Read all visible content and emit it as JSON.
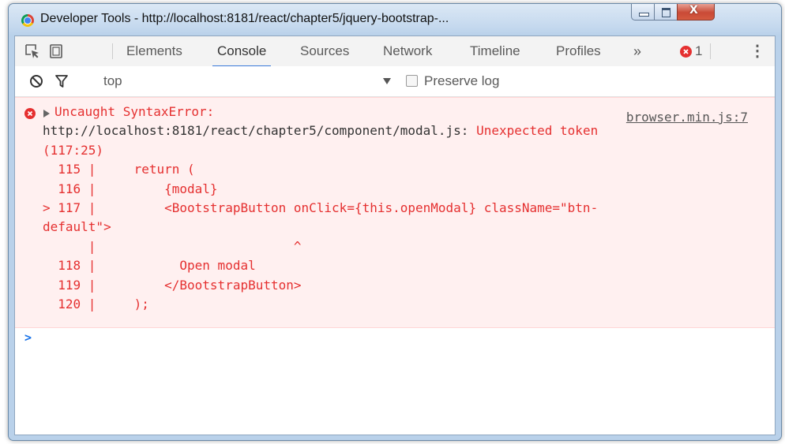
{
  "window": {
    "title": "Developer Tools - http://localhost:8181/react/chapter5/jquery-bootstrap-...",
    "close_glyph": "X"
  },
  "tabs": [
    {
      "label": "Elements"
    },
    {
      "label": "Console"
    },
    {
      "label": "Sources"
    },
    {
      "label": "Network"
    },
    {
      "label": "Timeline"
    },
    {
      "label": "Profiles"
    }
  ],
  "toolbar": {
    "more_tabs": "»",
    "error_count": "1",
    "menu_glyph": "⋮"
  },
  "filter": {
    "context": "top",
    "preserve_log_label": "Preserve log",
    "preserve_log_checked": false
  },
  "error": {
    "type": "Uncaught SyntaxError:",
    "source_link": "browser.min.js:7",
    "url": "http://localhost:8181/react/chapter5/component/modal.js:",
    "message": "Unexpected token",
    "position": "(117:25)",
    "code_lines": [
      "  115 |     return (",
      "  116 |         {modal}",
      "> 117 |         <BootstrapButton onClick={this.openModal} className=\"btn-",
      "default\">",
      "      |                          ^",
      "  118 |           Open modal",
      "  119 |         </BootstrapButton>",
      "  120 |     );"
    ]
  },
  "prompt": ">",
  "colors": {
    "error_text": "#e53030",
    "error_bg": "#fff0f0",
    "active_tab_underline": "#3879d9",
    "prompt": "#1a73e8"
  }
}
